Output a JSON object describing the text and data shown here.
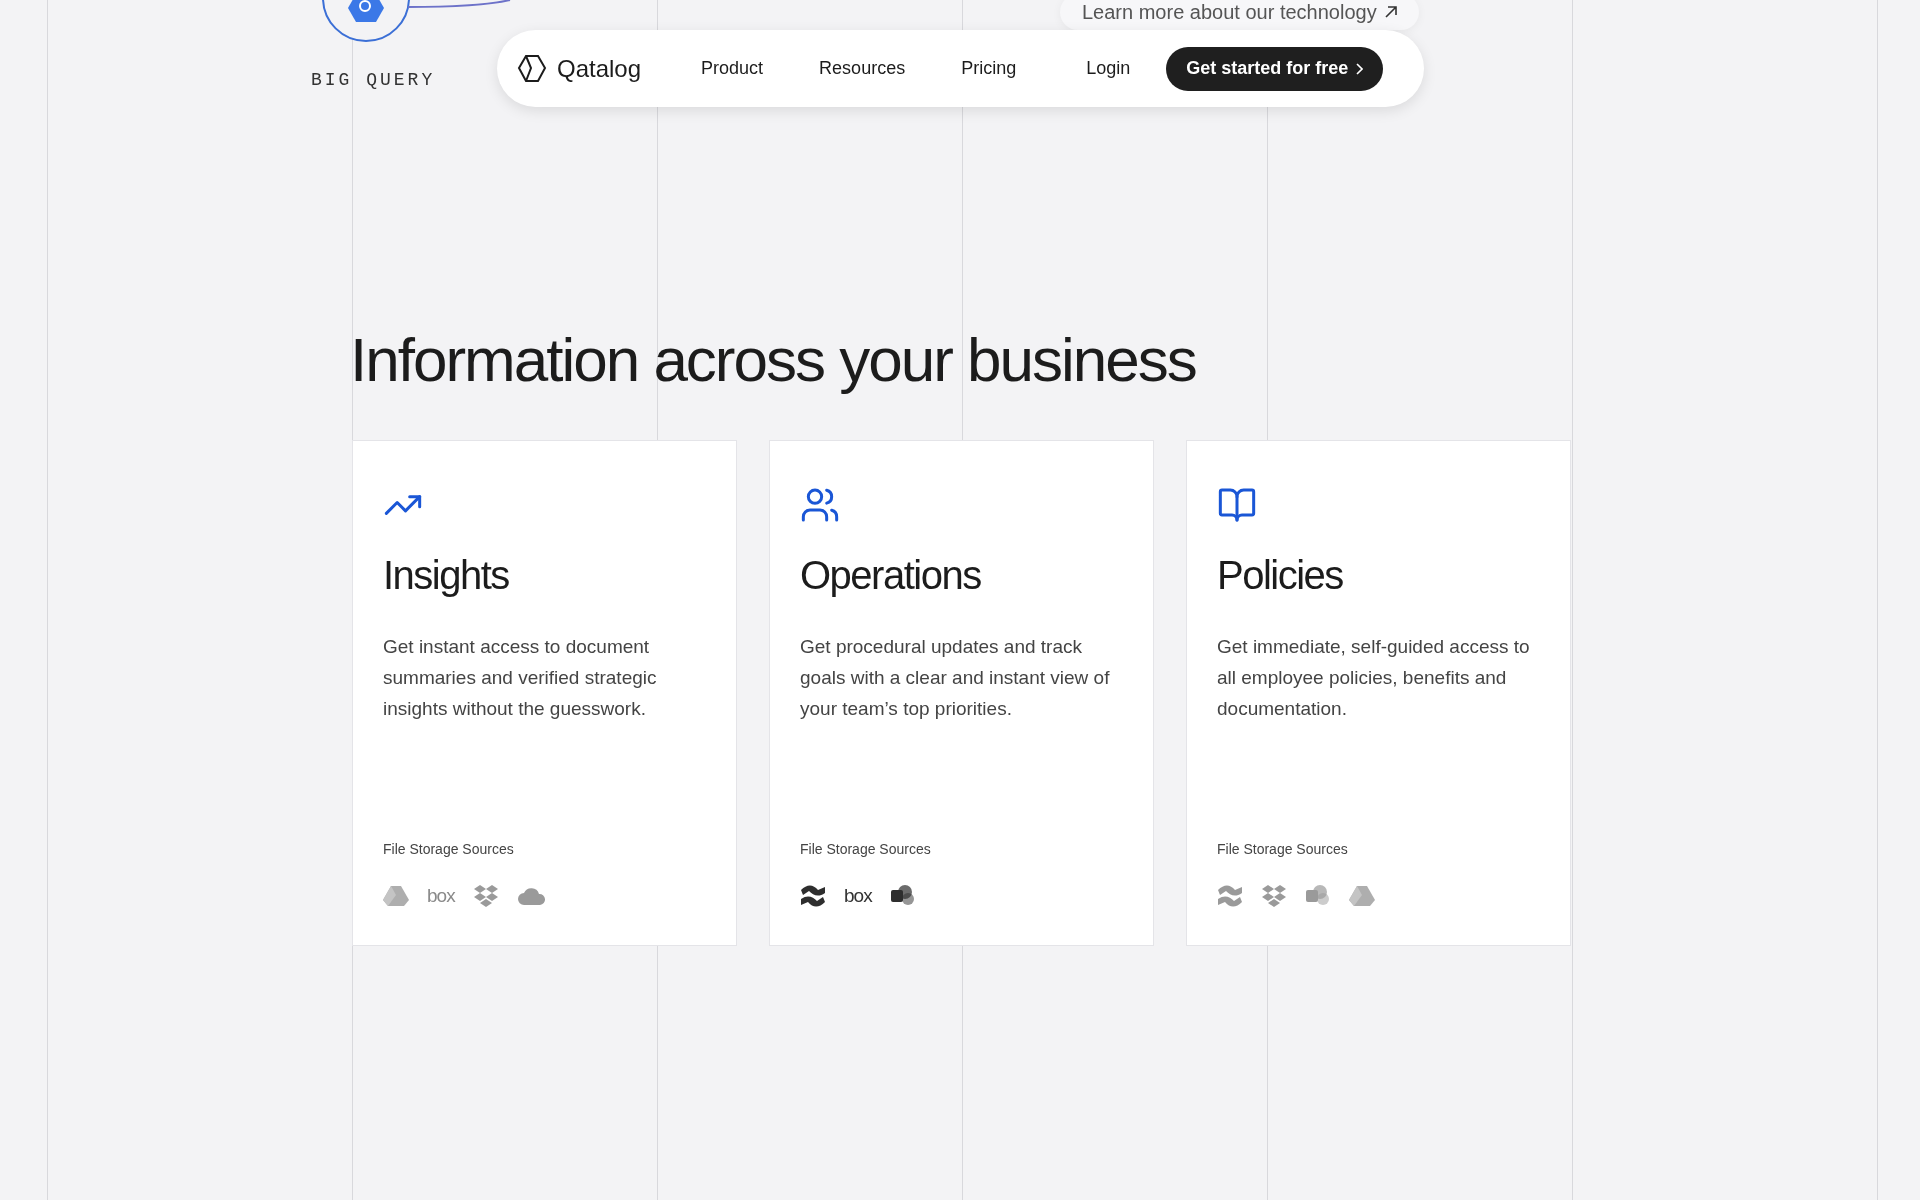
{
  "diagram_node": {
    "label": "BIG QUERY"
  },
  "floating_link": {
    "label": "Learn more about our technology"
  },
  "nav": {
    "brand": "Qatalog",
    "links": [
      "Product",
      "Resources",
      "Pricing",
      "Login"
    ],
    "cta": "Get started for free"
  },
  "heading": "Information across your business",
  "cards": [
    {
      "kind": "chart",
      "title": "Insights",
      "body": "Get instant access to document summaries and verified strategic insights without the guesswork.",
      "sources_label": "File Storage Sources",
      "sources": [
        {
          "kind": "drive"
        },
        {
          "kind": "box",
          "label": "box"
        },
        {
          "kind": "dropbox"
        },
        {
          "kind": "cloud"
        }
      ]
    },
    {
      "kind": "people",
      "title": "Operations",
      "body": "Get procedural updates and track goals with a clear and instant view of your team’s top priorities.",
      "sources_label": "File Storage Sources",
      "sources": [
        {
          "kind": "confluence"
        },
        {
          "kind": "box",
          "label": "box"
        },
        {
          "kind": "sharepoint"
        }
      ]
    },
    {
      "kind": "book",
      "title": "Policies",
      "body": "Get immediate, self-guided access to all employee policies, benefits and documentation.",
      "sources_label": "File Storage Sources",
      "sources": [
        {
          "kind": "confluence"
        },
        {
          "kind": "dropbox"
        },
        {
          "kind": "sharepoint"
        },
        {
          "kind": "drive"
        }
      ]
    }
  ]
}
